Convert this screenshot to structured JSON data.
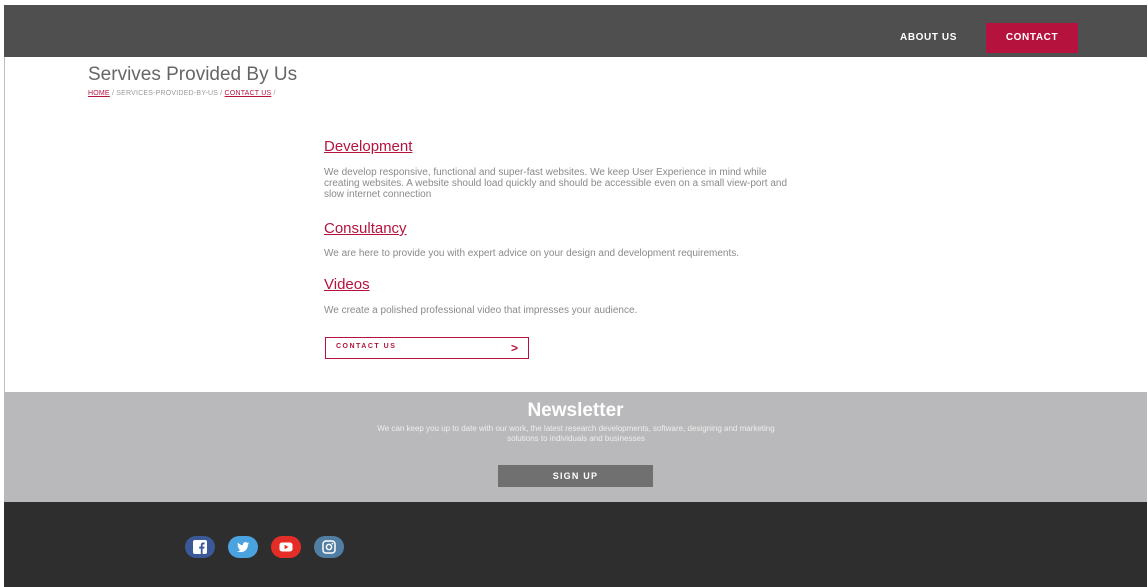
{
  "nav": {
    "about_label": "ABOUT US",
    "contact_label": "CONTACT"
  },
  "page": {
    "title": "Servives Provided By Us"
  },
  "breadcrumb": {
    "home": "HOME",
    "separator1": " / ",
    "middle": "SERVICES-PROVIDED-BY-US",
    "separator2": " / ",
    "last": "CONTACT US",
    "trailing": " /"
  },
  "services": [
    {
      "heading": "Development",
      "text": "We develop responsive, functional and super-fast websites. We keep User Experience in mind while creating websites. A website should load quickly and should be accessible even on a small view-port and slow internet connection"
    },
    {
      "heading": "Consultancy",
      "text": "We are here to provide you with expert advice on your design and development requirements."
    },
    {
      "heading": "Videos",
      "text": "We create a polished professional video that impresses your audience."
    }
  ],
  "contact_button": {
    "label": "CONTACT US",
    "arrow": ">"
  },
  "newsletter": {
    "title": "Newsletter",
    "text": "We can keep you up to date with our work, the latest research developments, software, designing and marketing solutions to individuals and businesses",
    "signup_label": "SIGN UP"
  },
  "social": [
    {
      "icon": "facebook-icon",
      "color": "#3b5998"
    },
    {
      "icon": "twitter-icon",
      "color": "#4aa3df"
    },
    {
      "icon": "youtube-icon",
      "color": "#e52d27"
    },
    {
      "icon": "instagram-icon",
      "color": "#517fa4"
    }
  ],
  "colors": {
    "accent": "#b5133e",
    "header_bg": "#4f4f4f",
    "newsletter_bg": "#b9b9bb",
    "footer_bg": "#2e2e2e"
  }
}
